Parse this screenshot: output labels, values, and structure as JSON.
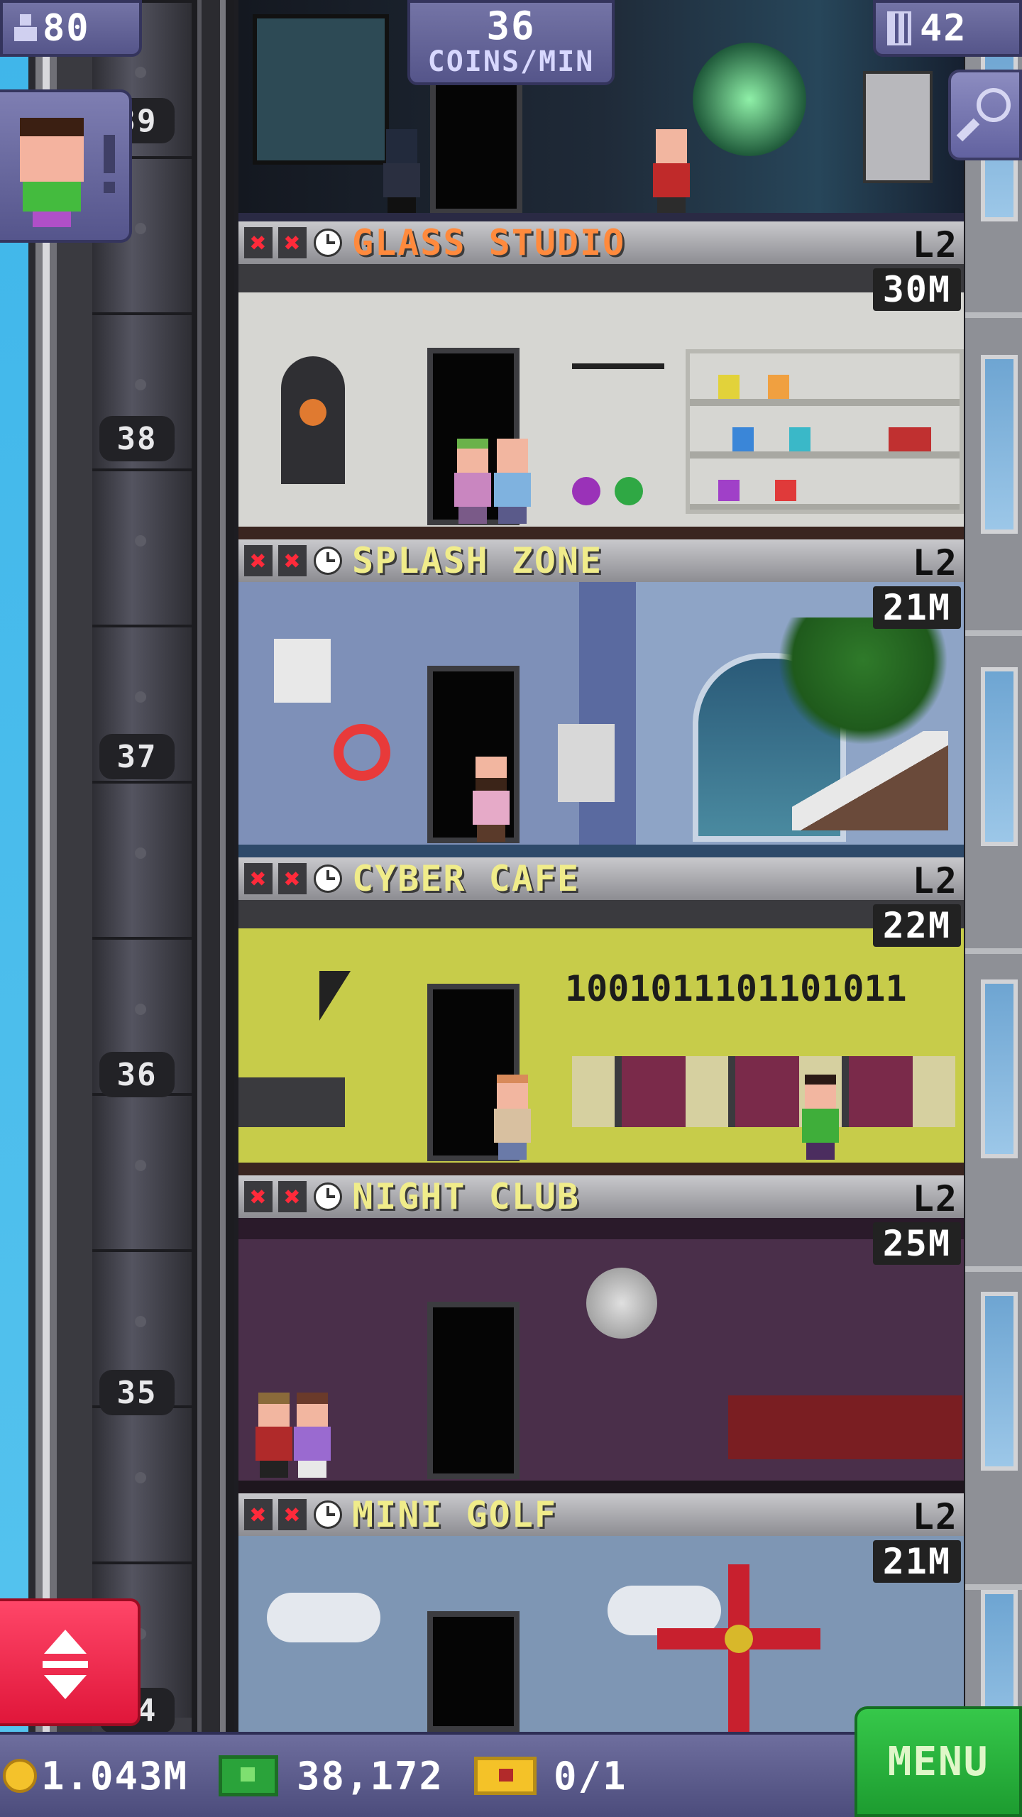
{
  "hud": {
    "population": "80",
    "coins_rate_value": "36",
    "coins_rate_unit": "COINS/MIN",
    "floor_count": "42"
  },
  "shaft": {
    "floor_numbers": [
      "39",
      "38",
      "37",
      "36",
      "35",
      "34"
    ]
  },
  "floors": [
    {
      "name": "GLASS STUDIO",
      "level": "L2",
      "badge": "30M",
      "name_color": "#ff8a3d"
    },
    {
      "name": "SPLASH ZONE",
      "level": "L2",
      "badge": "21M",
      "name_color": "#f0ec8a"
    },
    {
      "name": "CYBER CAFE",
      "level": "L2",
      "badge": "22M",
      "name_color": "#f0ec8a",
      "wall_text": "1001011101101011"
    },
    {
      "name": "NIGHT CLUB",
      "level": "L2",
      "badge": "25M",
      "name_color": "#f0ec8a"
    },
    {
      "name": "MINI GOLF",
      "level": "L2",
      "badge": "21M",
      "name_color": "#f0ec8a"
    }
  ],
  "icons": {
    "stock_out": "x-icon",
    "timer": "clock-icon",
    "search": "magnifier-icon",
    "elevator": "up-down-arrows-icon"
  },
  "bottom": {
    "coins": "1.043M",
    "bux": "38,172",
    "tickets": "0/1",
    "menu_label": "MENU"
  },
  "colors": {
    "menu": "#2bb53f",
    "elevator_button": "#f0284c",
    "hud": "#6363a0"
  }
}
